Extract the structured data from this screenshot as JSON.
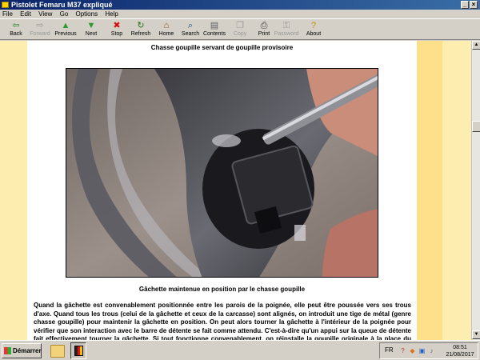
{
  "window": {
    "title": "Pistolet Femaru M37 expliqué"
  },
  "menu": [
    "File",
    "Edit",
    "View",
    "Go",
    "Options",
    "Help"
  ],
  "toolbar": [
    {
      "label": "Back",
      "icon": "back-arrow-icon",
      "glyph": "⇦",
      "color": "#2a8a2a",
      "enabled": true
    },
    {
      "label": "Forward",
      "icon": "forward-arrow-icon",
      "glyph": "⇨",
      "color": "#9a9a9a",
      "enabled": false
    },
    {
      "label": "Previous",
      "icon": "up-arrow-icon",
      "glyph": "▲",
      "color": "#2a9a2a",
      "enabled": true
    },
    {
      "label": "Next",
      "icon": "down-arrow-icon",
      "glyph": "▼",
      "color": "#2a9a2a",
      "enabled": true
    },
    {
      "label": "Stop",
      "icon": "stop-icon",
      "glyph": "✖",
      "color": "#d01010",
      "enabled": true
    },
    {
      "label": "Refresh",
      "icon": "refresh-icon",
      "glyph": "↻",
      "color": "#207020",
      "enabled": true
    },
    {
      "label": "Home",
      "icon": "home-icon",
      "glyph": "⌂",
      "color": "#805020",
      "enabled": true
    },
    {
      "label": "Search",
      "icon": "search-icon",
      "glyph": "⌕",
      "color": "#204080",
      "enabled": true
    },
    {
      "label": "Contents",
      "icon": "contents-icon",
      "glyph": "▤",
      "color": "#606060",
      "enabled": true
    },
    {
      "label": "Copy",
      "icon": "copy-icon",
      "glyph": "❐",
      "color": "#9a9a9a",
      "enabled": false
    },
    {
      "label": "Print",
      "icon": "print-icon",
      "glyph": "⎙",
      "color": "#404040",
      "enabled": true
    },
    {
      "label": "Password",
      "icon": "password-icon",
      "glyph": "⚿",
      "color": "#9a9a9a",
      "enabled": false
    },
    {
      "label": "About",
      "icon": "about-icon",
      "glyph": "?",
      "color": "#c09000",
      "enabled": true
    }
  ],
  "content": {
    "caption_top": "Chasse goupille servant de goupille provisoire",
    "caption_bottom": "Gâchette maintenue en position par le chasse goupille",
    "paragraph": "Quand la gâchette est convenablement positionnée entre les parois de la poignée, elle peut être poussée vers ses trous d'axe. Quand tous les trous (celui de la gâchette et ceux de la carcasse) sont alignés, on introduit une tige de métal (genre chasse goupille) pour maintenir la gâchette en position. On peut alors tourner la gâchette à l'intérieur de la poignée pour vérifier que son interaction avec le barre de détente se fait comme attendu. C'est-à-dire qu'un appui sur la queue de détente fait effectivement tourner la gâchette. Si tout fonctionne convenablement, on réinstalle la goupille originale à la place du chasse"
  },
  "taskbar": {
    "start_label": "Démarrer",
    "lang": "FR",
    "time": "08:51",
    "date": "21/08/2017"
  }
}
